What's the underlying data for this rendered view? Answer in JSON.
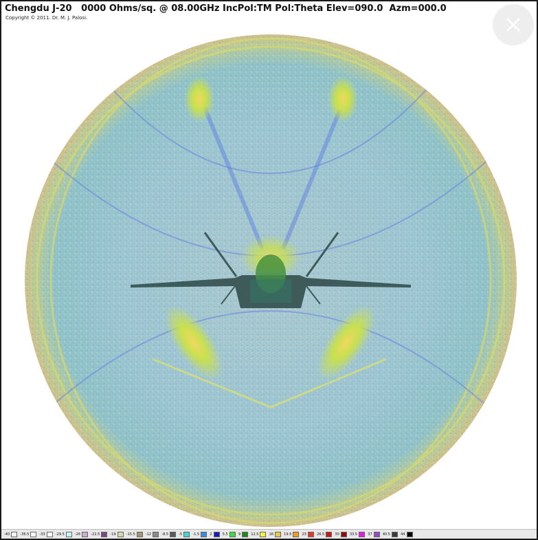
{
  "window": {
    "title": "Chengdu J-20   0000 Ohms/sq. @ 08.00GHz IncPol:TM Pol:Theta Elev=090.0  Azm=000.0",
    "copyright": "Copyright © 2011. Dr. M. J. Palosi."
  },
  "controls": {
    "close_icon": "close-icon"
  },
  "legend": {
    "entries": [
      {
        "label": "-40",
        "color": "#f4f4f4"
      },
      {
        "label": "-36.5",
        "color": "#ffffff"
      },
      {
        "label": "-33",
        "color": "#ffffff"
      },
      {
        "label": "-29.5",
        "color": "#c8f4f8"
      },
      {
        "label": "-26",
        "color": "#d4a6d8"
      },
      {
        "label": "-22.5",
        "color": "#7a4a86"
      },
      {
        "label": "-19",
        "color": "#d8d8b0"
      },
      {
        "label": "-15.5",
        "color": "#9a9a7a"
      },
      {
        "label": "-12",
        "color": "#8a8a8a"
      },
      {
        "label": "-8.5",
        "color": "#5a5a5a"
      },
      {
        "label": "-5",
        "color": "#3ed8d8"
      },
      {
        "label": "-1.5",
        "color": "#3a8ae0"
      },
      {
        "label": "2",
        "color": "#1818c8"
      },
      {
        "label": "5.5",
        "color": "#3ae03a"
      },
      {
        "label": "9",
        "color": "#1a8a1a"
      },
      {
        "label": "12.5",
        "color": "#f4f438"
      },
      {
        "label": "16",
        "color": "#e8c848"
      },
      {
        "label": "19.5",
        "color": "#f49a28"
      },
      {
        "label": "23",
        "color": "#e83828"
      },
      {
        "label": "26.5",
        "color": "#c81818"
      },
      {
        "label": "30",
        "color": "#8a1010"
      },
      {
        "label": "33.5",
        "color": "#e818e8"
      },
      {
        "label": "37",
        "color": "#9a4ac8"
      },
      {
        "label": "40.5",
        "color": "#3a3a3a"
      },
      {
        "label": "44",
        "color": "#080808"
      }
    ]
  },
  "colors": {
    "sphere_base": "#8fc4cc",
    "sphere_rim": "#b8c890",
    "lobe": "#c8e050",
    "aircraft": "#2f4a4a"
  }
}
